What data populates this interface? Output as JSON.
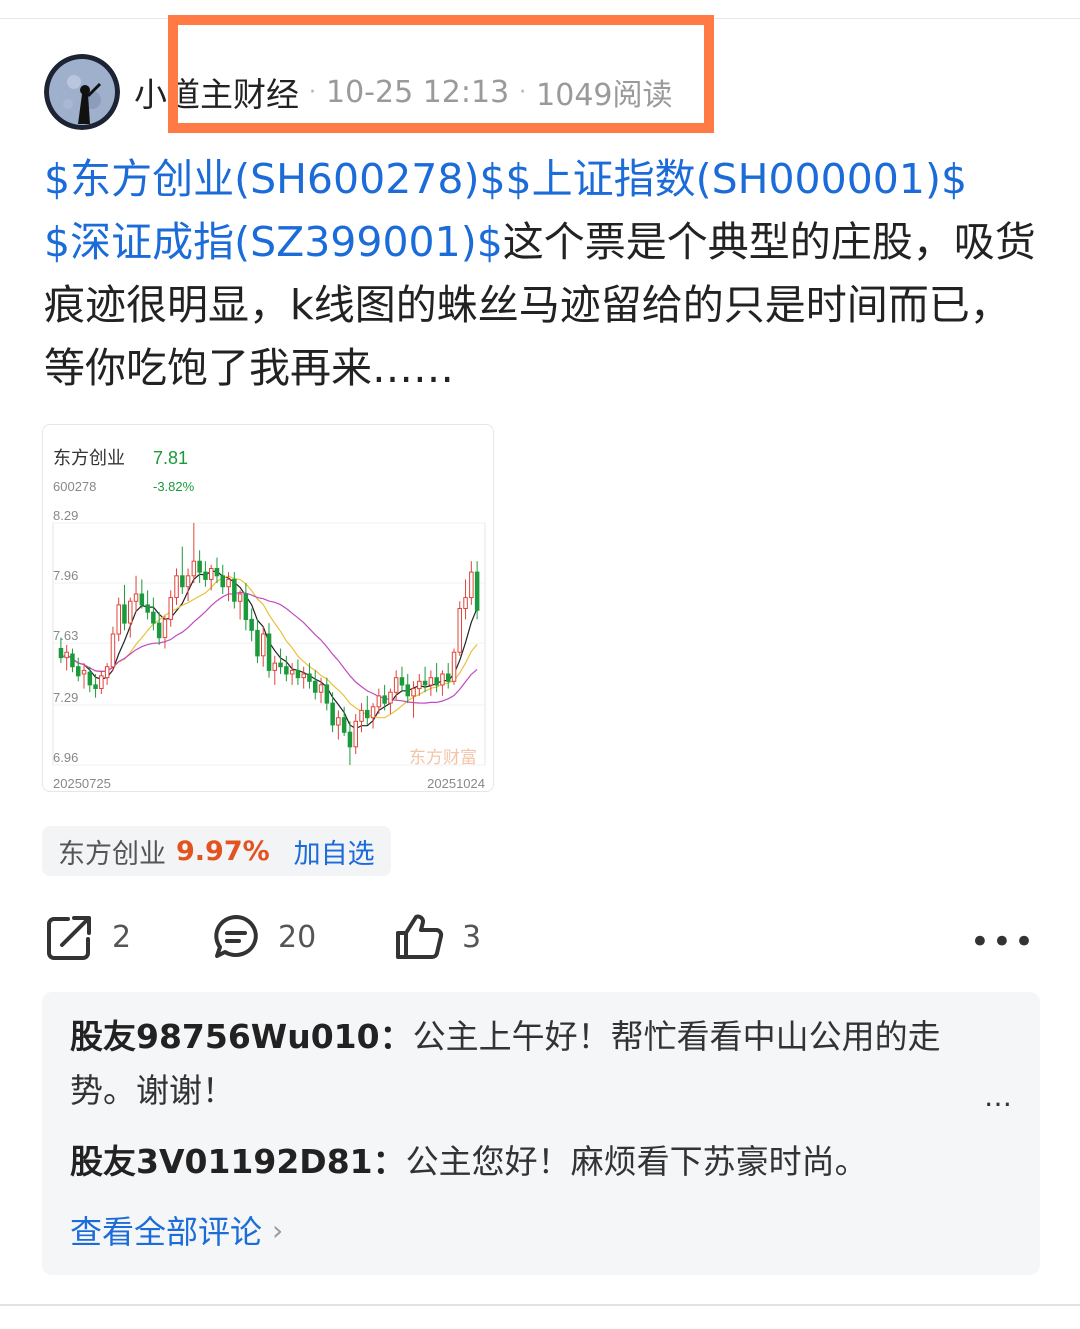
{
  "post": {
    "author": "小道主财经",
    "time": "10-25 12:13",
    "reads": "1049阅读",
    "tags": [
      "$东方创业(SH600278)$",
      "$上证指数(SH000001)$",
      "$深证成指(SZ399001)$"
    ],
    "body": "这个票是个典型的庄股，吸货痕迹很明显，k线图的蛛丝马迹留给的只是时间而已，等你吃饱了我再来……"
  },
  "chart_card": {
    "name": "东方创业",
    "code": "600278",
    "price": "7.81",
    "change": "-3.82%",
    "watermark": "东方财富",
    "price_color_down": "#1a9a3a",
    "price_color_up": "#e0443a"
  },
  "chart_data": {
    "type": "candlestick",
    "y_ticks": [
      "8.29",
      "7.96",
      "7.63",
      "7.29",
      "6.96"
    ],
    "x_labels": [
      "20250725",
      "20251024"
    ],
    "ylim": [
      6.96,
      8.29
    ],
    "candles": [
      {
        "o": 7.6,
        "h": 7.66,
        "l": 7.52,
        "c": 7.55
      },
      {
        "o": 7.55,
        "h": 7.62,
        "l": 7.48,
        "c": 7.58
      },
      {
        "o": 7.57,
        "h": 7.6,
        "l": 7.47,
        "c": 7.5
      },
      {
        "o": 7.5,
        "h": 7.55,
        "l": 7.42,
        "c": 7.45
      },
      {
        "o": 7.46,
        "h": 7.52,
        "l": 7.38,
        "c": 7.48
      },
      {
        "o": 7.47,
        "h": 7.5,
        "l": 7.36,
        "c": 7.4
      },
      {
        "o": 7.4,
        "h": 7.46,
        "l": 7.33,
        "c": 7.38
      },
      {
        "o": 7.38,
        "h": 7.48,
        "l": 7.35,
        "c": 7.45
      },
      {
        "o": 7.44,
        "h": 7.52,
        "l": 7.4,
        "c": 7.5
      },
      {
        "o": 7.5,
        "h": 7.72,
        "l": 7.48,
        "c": 7.68
      },
      {
        "o": 7.68,
        "h": 7.88,
        "l": 7.64,
        "c": 7.84
      },
      {
        "o": 7.84,
        "h": 7.95,
        "l": 7.7,
        "c": 7.74
      },
      {
        "o": 7.74,
        "h": 7.88,
        "l": 7.66,
        "c": 7.86
      },
      {
        "o": 7.86,
        "h": 8.0,
        "l": 7.8,
        "c": 7.9
      },
      {
        "o": 7.9,
        "h": 7.98,
        "l": 7.82,
        "c": 7.84
      },
      {
        "o": 7.84,
        "h": 7.92,
        "l": 7.76,
        "c": 7.8
      },
      {
        "o": 7.8,
        "h": 7.88,
        "l": 7.7,
        "c": 7.74
      },
      {
        "o": 7.74,
        "h": 7.8,
        "l": 7.62,
        "c": 7.66
      },
      {
        "o": 7.66,
        "h": 7.78,
        "l": 7.6,
        "c": 7.76
      },
      {
        "o": 7.76,
        "h": 7.92,
        "l": 7.72,
        "c": 7.88
      },
      {
        "o": 7.88,
        "h": 8.04,
        "l": 7.84,
        "c": 8.0
      },
      {
        "o": 8.0,
        "h": 8.16,
        "l": 7.9,
        "c": 7.94
      },
      {
        "o": 7.94,
        "h": 8.04,
        "l": 7.86,
        "c": 8.0
      },
      {
        "o": 8.0,
        "h": 8.29,
        "l": 7.96,
        "c": 8.08
      },
      {
        "o": 8.08,
        "h": 8.14,
        "l": 7.96,
        "c": 8.02
      },
      {
        "o": 8.02,
        "h": 8.08,
        "l": 7.94,
        "c": 7.98
      },
      {
        "o": 7.98,
        "h": 8.06,
        "l": 7.92,
        "c": 8.04
      },
      {
        "o": 8.04,
        "h": 8.1,
        "l": 7.96,
        "c": 8.0
      },
      {
        "o": 8.0,
        "h": 8.06,
        "l": 7.9,
        "c": 7.94
      },
      {
        "o": 7.94,
        "h": 8.02,
        "l": 7.86,
        "c": 7.98
      },
      {
        "o": 7.98,
        "h": 8.02,
        "l": 7.82,
        "c": 7.86
      },
      {
        "o": 7.86,
        "h": 7.92,
        "l": 7.76,
        "c": 7.9
      },
      {
        "o": 7.9,
        "h": 7.96,
        "l": 7.7,
        "c": 7.76
      },
      {
        "o": 7.76,
        "h": 7.82,
        "l": 7.64,
        "c": 7.7
      },
      {
        "o": 7.7,
        "h": 7.76,
        "l": 7.52,
        "c": 7.56
      },
      {
        "o": 7.56,
        "h": 7.72,
        "l": 7.5,
        "c": 7.68
      },
      {
        "o": 7.68,
        "h": 7.74,
        "l": 7.44,
        "c": 7.48
      },
      {
        "o": 7.48,
        "h": 7.56,
        "l": 7.4,
        "c": 7.52
      },
      {
        "o": 7.52,
        "h": 7.6,
        "l": 7.46,
        "c": 7.5
      },
      {
        "o": 7.5,
        "h": 7.56,
        "l": 7.42,
        "c": 7.46
      },
      {
        "o": 7.46,
        "h": 7.52,
        "l": 7.4,
        "c": 7.48
      },
      {
        "o": 7.48,
        "h": 7.54,
        "l": 7.4,
        "c": 7.44
      },
      {
        "o": 7.44,
        "h": 7.5,
        "l": 7.38,
        "c": 7.46
      },
      {
        "o": 7.46,
        "h": 7.52,
        "l": 7.38,
        "c": 7.42
      },
      {
        "o": 7.42,
        "h": 7.48,
        "l": 7.32,
        "c": 7.36
      },
      {
        "o": 7.36,
        "h": 7.44,
        "l": 7.3,
        "c": 7.4
      },
      {
        "o": 7.4,
        "h": 7.44,
        "l": 7.26,
        "c": 7.3
      },
      {
        "o": 7.3,
        "h": 7.36,
        "l": 7.14,
        "c": 7.18
      },
      {
        "o": 7.18,
        "h": 7.26,
        "l": 7.1,
        "c": 7.22
      },
      {
        "o": 7.22,
        "h": 7.28,
        "l": 7.12,
        "c": 7.14
      },
      {
        "o": 7.14,
        "h": 7.2,
        "l": 6.96,
        "c": 7.06
      },
      {
        "o": 7.06,
        "h": 7.24,
        "l": 7.02,
        "c": 7.2
      },
      {
        "o": 7.2,
        "h": 7.3,
        "l": 7.14,
        "c": 7.26
      },
      {
        "o": 7.26,
        "h": 7.34,
        "l": 7.18,
        "c": 7.22
      },
      {
        "o": 7.22,
        "h": 7.3,
        "l": 7.16,
        "c": 7.28
      },
      {
        "o": 7.28,
        "h": 7.38,
        "l": 7.24,
        "c": 7.34
      },
      {
        "o": 7.34,
        "h": 7.4,
        "l": 7.26,
        "c": 7.3
      },
      {
        "o": 7.3,
        "h": 7.38,
        "l": 7.24,
        "c": 7.36
      },
      {
        "o": 7.36,
        "h": 7.48,
        "l": 7.32,
        "c": 7.44
      },
      {
        "o": 7.44,
        "h": 7.5,
        "l": 7.36,
        "c": 7.4
      },
      {
        "o": 7.4,
        "h": 7.46,
        "l": 7.3,
        "c": 7.34
      },
      {
        "o": 7.34,
        "h": 7.42,
        "l": 7.22,
        "c": 7.38
      },
      {
        "o": 7.38,
        "h": 7.46,
        "l": 7.34,
        "c": 7.42
      },
      {
        "o": 7.42,
        "h": 7.5,
        "l": 7.36,
        "c": 7.4
      },
      {
        "o": 7.4,
        "h": 7.48,
        "l": 7.34,
        "c": 7.44
      },
      {
        "o": 7.44,
        "h": 7.52,
        "l": 7.36,
        "c": 7.4
      },
      {
        "o": 7.4,
        "h": 7.48,
        "l": 7.34,
        "c": 7.46
      },
      {
        "o": 7.46,
        "h": 7.52,
        "l": 7.38,
        "c": 7.42
      },
      {
        "o": 7.42,
        "h": 7.6,
        "l": 7.4,
        "c": 7.58
      },
      {
        "o": 7.58,
        "h": 7.86,
        "l": 7.56,
        "c": 7.82
      },
      {
        "o": 7.82,
        "h": 7.98,
        "l": 7.76,
        "c": 7.88
      },
      {
        "o": 7.88,
        "h": 8.08,
        "l": 7.84,
        "c": 8.02
      },
      {
        "o": 8.02,
        "h": 8.08,
        "l": 7.76,
        "c": 7.81
      }
    ]
  },
  "stock_pill": {
    "name": "东方创业",
    "change": "9.97%",
    "add_label": "加自选"
  },
  "actions": {
    "share_count": "2",
    "comment_count": "20",
    "like_count": "3",
    "more": "•••"
  },
  "comments": {
    "items": [
      {
        "user": "股友98756Wu010：",
        "text": "公主上午好！帮忙看看中山公用的走势。谢谢！"
      },
      {
        "user": "股友3V01192D81：",
        "text": "公主您好！麻烦看下苏豪时尚。"
      }
    ],
    "more_label": "…",
    "view_all": "查看全部评论",
    "chevron": "›"
  }
}
